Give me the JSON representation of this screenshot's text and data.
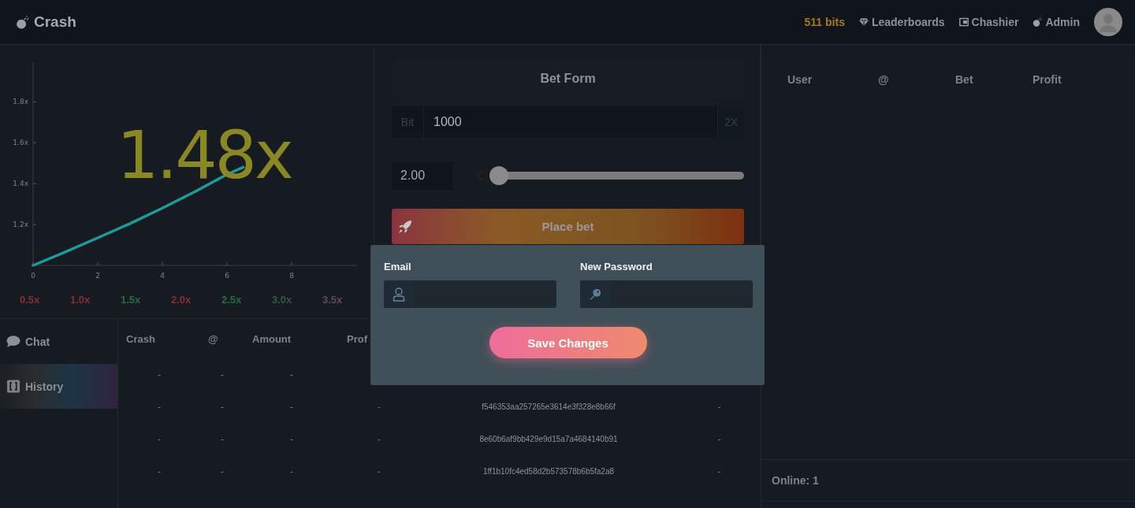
{
  "header": {
    "logo": "Crash",
    "balance": "511 bits",
    "nav": [
      {
        "kind": "diamond",
        "label": "Leaderboards"
      },
      {
        "kind": "wallet",
        "label": "Chashier"
      },
      {
        "kind": "bomb",
        "label": "Admin"
      }
    ]
  },
  "game": {
    "current_multiplier": "1.48x",
    "chart_data": {
      "type": "line",
      "x": [
        0,
        1,
        2,
        3,
        4,
        5,
        6,
        6.5
      ],
      "xlim": [
        0,
        10
      ],
      "ylim": [
        1.0,
        1.99
      ],
      "series": [
        {
          "color": "#1f9a9a",
          "values": [
            1.0,
            1.066,
            1.135,
            1.205,
            1.28,
            1.36,
            1.445,
            1.48
          ]
        }
      ],
      "xticks": [
        0,
        2,
        4,
        6,
        8
      ],
      "yticks": [
        {
          "value": 1.2,
          "label": "1.2x"
        },
        {
          "value": 1.4,
          "label": "1.4x"
        },
        {
          "value": 1.6,
          "label": "1.6x"
        },
        {
          "value": 1.8,
          "label": "1.8x"
        }
      ]
    },
    "recent_crashes": [
      {
        "label": "0.5x",
        "color": "#8e2b33"
      },
      {
        "label": "1.0x",
        "color": "#8e2b33"
      },
      {
        "label": "1.5x",
        "color": "#2b6b42"
      },
      {
        "label": "2.0x",
        "color": "#8e2b33"
      },
      {
        "label": "2.5x",
        "color": "#2b6b42"
      },
      {
        "label": "3.0x",
        "color": "#2f5a40"
      },
      {
        "label": "3.5x",
        "color": "#654562"
      }
    ]
  },
  "bet_form": {
    "title": "Bet Form",
    "amount": {
      "prefix": "Bit",
      "value": "1000",
      "double_button": "2X"
    },
    "payout": {
      "value": "2.00",
      "level": 0.08
    },
    "place_button": "Place bet"
  },
  "tabs": [
    {
      "kind": "chat",
      "label": "Chat",
      "selected": false
    },
    {
      "kind": "history",
      "label": "History",
      "selected": true
    }
  ],
  "history": {
    "columns": [
      "Crash",
      "@",
      "Amount",
      "Prof"
    ],
    "rows": [
      [
        "-",
        "-",
        "-"
      ],
      [
        "-",
        "-",
        "-",
        "-",
        "f546353aa257265e3614e3f328e8b66f",
        "-"
      ],
      [
        "-",
        "-",
        "-",
        "-",
        "8e60b6af9bb429e9d15a7a4684140b91",
        "-"
      ],
      [
        "-",
        "-",
        "-",
        "-",
        "1ff1b10fc4ed58d2b573578b6b5fa2a8",
        "-"
      ]
    ]
  },
  "players": {
    "columns": [
      "User",
      "@",
      "Bet",
      "Profit"
    ],
    "online": "Online: 1"
  },
  "modal": {
    "fields": [
      {
        "label": "Email",
        "kind": "user"
      },
      {
        "label": "New Password",
        "kind": "key"
      }
    ],
    "save_button": "Save Changes"
  }
}
